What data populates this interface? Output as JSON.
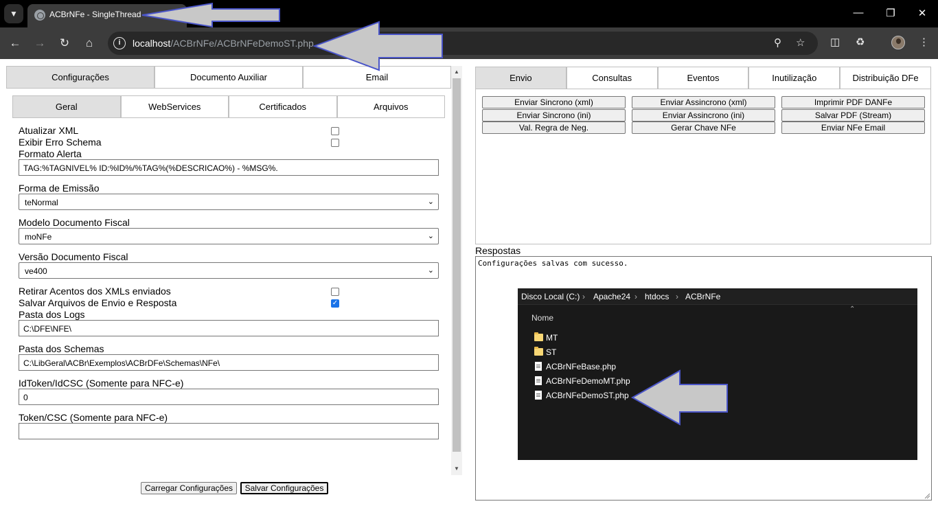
{
  "browser": {
    "tab_title": "ACBrNFe - SingleThread",
    "url_host": "localhost",
    "url_path": "/ACBrNFe/ACBrNFeDemoST.php"
  },
  "left_panel": {
    "tabs": [
      "Configurações",
      "Documento Auxiliar",
      "Email"
    ],
    "sub_tabs": [
      "Geral",
      "WebServices",
      "Certificados",
      "Arquivos"
    ],
    "fields": {
      "atualizar_xml_label": "Atualizar XML",
      "exibir_erro_label": "Exibir Erro Schema",
      "formato_alerta_label": "Formato Alerta",
      "formato_alerta_value": "TAG:%TAGNIVEL% ID:%ID%/%TAG%(%DESCRICAO%) - %MSG%.",
      "forma_emissao_label": "Forma de Emissão",
      "forma_emissao_value": "teNormal",
      "modelo_label": "Modelo Documento Fiscal",
      "modelo_value": "moNFe",
      "versao_label": "Versão Documento Fiscal",
      "versao_value": "ve400",
      "retirar_acentos_label": "Retirar Acentos dos XMLs enviados",
      "salvar_arquivos_label": "Salvar Arquivos de Envio e Resposta",
      "pasta_logs_label": "Pasta dos Logs",
      "pasta_logs_value": "C:\\DFE\\NFE\\",
      "pasta_schemas_label": "Pasta dos Schemas",
      "pasta_schemas_value": "C:\\LibGeral\\ACBr\\Exemplos\\ACBrDFe\\Schemas\\NFe\\",
      "idtoken_label": "IdToken/IdCSC (Somente para NFC-e)",
      "idtoken_value": "0",
      "token_label": "Token/CSC (Somente para NFC-e)",
      "token_value": ""
    },
    "checkboxes": {
      "atualizar_xml": false,
      "exibir_erro": false,
      "retirar_acentos": false,
      "salvar_arquivos": true
    },
    "buttons": {
      "carregar": "Carregar Configurações",
      "salvar": "Salvar Configurações"
    }
  },
  "right_panel": {
    "tabs": [
      "Envio",
      "Consultas",
      "Eventos",
      "Inutilização",
      "Distribuição DFe"
    ],
    "buttons": [
      "Enviar Sincrono (xml)",
      "Enviar Assincrono (xml)",
      "Imprimir PDF DANFe",
      "Enviar Sincrono (ini)",
      "Enviar Assincrono (ini)",
      "Salvar PDF (Stream)",
      "Val. Regra de Neg.",
      "Gerar Chave NFe",
      "Enviar NFe Email"
    ],
    "respostas_label": "Respostas",
    "respostas_text": "Configurações salvas com sucesso."
  },
  "explorer": {
    "breadcrumb": [
      "Disco Local (C:)",
      "Apache24",
      "htdocs",
      "ACBrNFe"
    ],
    "column_header": "Nome",
    "items": [
      {
        "name": "MT",
        "type": "folder"
      },
      {
        "name": "ST",
        "type": "folder"
      },
      {
        "name": "ACBrNFeBase.php",
        "type": "file"
      },
      {
        "name": "ACBrNFeDemoMT.php",
        "type": "file"
      },
      {
        "name": "ACBrNFeDemoST.php",
        "type": "file"
      }
    ]
  },
  "colors": {
    "annotation_fill": "#c8c8c8",
    "annotation_stroke": "#4a55c8",
    "checkbox_accent": "#1a73e8"
  }
}
